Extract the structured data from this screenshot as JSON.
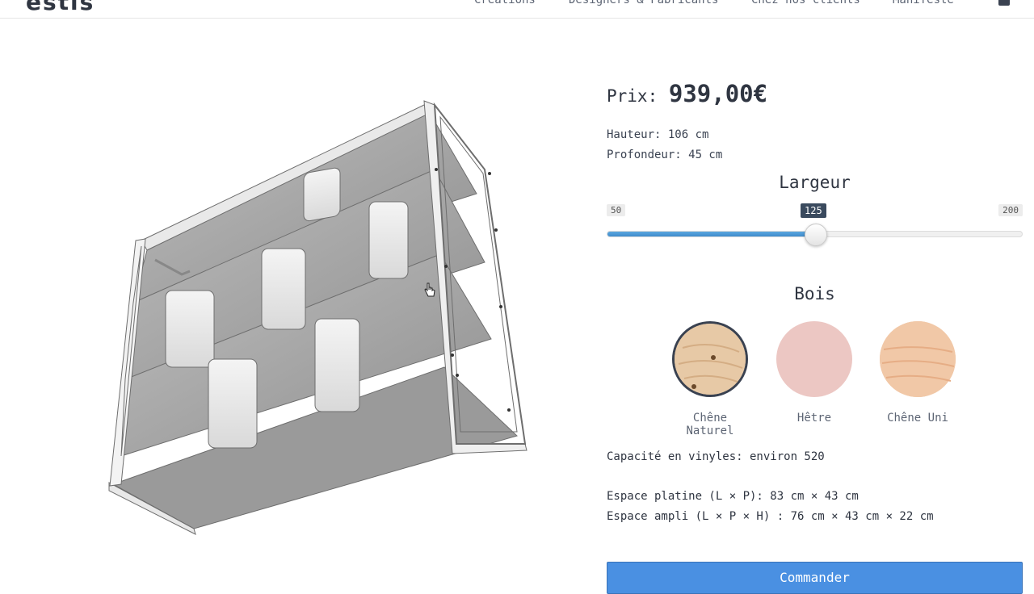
{
  "header": {
    "logo": "estis",
    "nav": [
      "Créations",
      "Designers & Fabricants",
      "Chez nos clients",
      "Manifeste"
    ],
    "cart_icon": "bag-icon"
  },
  "product": {
    "price_label": "Prix:",
    "price_value": "939,00€",
    "hauteur": "Hauteur: 106 cm",
    "profondeur": "Profondeur: 45 cm"
  },
  "largeur": {
    "title": "Largeur",
    "min": "50",
    "max": "200",
    "value": "125",
    "fraction": 0.5
  },
  "bois": {
    "title": "Bois",
    "options": [
      {
        "label": "Chêne Naturel",
        "selected": true,
        "color": "#e7c9a6"
      },
      {
        "label": "Hêtre",
        "selected": false,
        "color": "#ecc7c3"
      },
      {
        "label": "Chêne Uni",
        "selected": false,
        "color": "#f1c8a7"
      }
    ]
  },
  "capacite": "Capacité en vinyles: environ 520",
  "espace_platine": "Espace platine (L × P): 83 cm × 43 cm",
  "espace_ampli": "Espace ampli (L × P × H) : 76 cm × 43 cm × 22 cm",
  "order_button": "Commander",
  "colors": {
    "accent": "#4a90e2",
    "slider_fill": "#4e9ad6",
    "text": "#2f3541"
  }
}
